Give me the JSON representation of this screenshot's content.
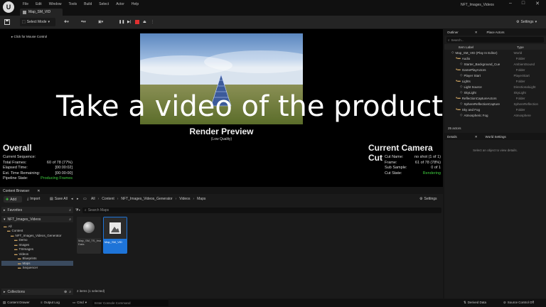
{
  "titlebar": {
    "menu": [
      "File",
      "Edit",
      "Window",
      "Tools",
      "Build",
      "Select",
      "Actor",
      "Help"
    ],
    "level_tab": "Map_SM_VID",
    "project": "NFT_Images_Videos"
  },
  "toolbar": {
    "select_mode": "Select Mode",
    "settings": "Settings"
  },
  "viewport": {
    "click_hint": "Click for Mouse Control",
    "overlay_text": "Take a video of the product",
    "render_preview": "Render Preview",
    "quality": "(Low Quality)",
    "overall": {
      "title": "Overall",
      "rows": [
        {
          "label": "Current Sequence:",
          "value": ""
        },
        {
          "label": "Total Frames:",
          "value": "60 of 78 (77%)"
        },
        {
          "label": "Elapsed Time:",
          "value": "[00:00:02]"
        },
        {
          "label": "Est. Time Remaining:",
          "value": "[00:00:00]"
        },
        {
          "label": "Pipeline State:",
          "value": "Producing Frames"
        }
      ]
    },
    "camera_cut": {
      "title": "Current Camera Cut",
      "rows": [
        {
          "label": "Cut Name:",
          "value": "no shot (1 of 1)"
        },
        {
          "label": "Frame:",
          "value": "61 of 78 (78%)"
        },
        {
          "label": "Sub Sample:",
          "value": "0 of 1"
        },
        {
          "label": "Cut State:",
          "value": "Rendering"
        }
      ]
    }
  },
  "outliner": {
    "tab": "Outliner",
    "tab2": "Place Actors",
    "search_placeholder": "Search...",
    "col_label": "Item Label",
    "col_type": "Type",
    "rows": [
      {
        "label": "Map_SM_VID (Play In Editor)",
        "type": "World",
        "indent": 1
      },
      {
        "label": "Audio",
        "type": "Folder",
        "indent": 2
      },
      {
        "label": "Starter_Background_Cue",
        "type": "AmbientSound",
        "indent": 3
      },
      {
        "label": "GamePlayActors",
        "type": "Folder",
        "indent": 2
      },
      {
        "label": "Player Start",
        "type": "PlayerStart",
        "indent": 3
      },
      {
        "label": "Lights",
        "type": "Folder",
        "indent": 2
      },
      {
        "label": "Light Source",
        "type": "DirectionalLight",
        "indent": 3
      },
      {
        "label": "SkyLight",
        "type": "SkyLight",
        "indent": 3
      },
      {
        "label": "ReflectionCaptureActors",
        "type": "Folder",
        "indent": 2
      },
      {
        "label": "SphereReflectionCapture",
        "type": "SphereReflection",
        "indent": 3
      },
      {
        "label": "Sky and Fog",
        "type": "Folder",
        "indent": 2
      },
      {
        "label": "Atmospheric Fog",
        "type": "Atmosphere",
        "indent": 3
      }
    ],
    "count": "25 actors"
  },
  "details": {
    "tab": "Details",
    "tab2": "World Settings",
    "hint": "Select an object to view details."
  },
  "content_browser": {
    "tab": "Content Browser",
    "add": "Add",
    "import": "Import",
    "save_all": "Save All",
    "breadcrumbs": [
      "All",
      "Content",
      "NFT_Images_Videos_Generator",
      "Videos",
      "Maps"
    ],
    "settings": "Settings",
    "favorites": "Favorites",
    "project": "NFT_Images_Videos",
    "search_placeholder": "Search Maps",
    "tree": [
      {
        "label": "All",
        "indent": 0
      },
      {
        "label": "Content",
        "indent": 1
      },
      {
        "label": "NFT_Images_Videos_Generator",
        "indent": 2
      },
      {
        "label": "Demo",
        "indent": 3
      },
      {
        "label": "Images",
        "indent": 3
      },
      {
        "label": "TSImages",
        "indent": 3
      },
      {
        "label": "Videos",
        "indent": 3
      },
      {
        "label": "Blueprints",
        "indent": 4
      },
      {
        "label": "Maps",
        "indent": 4
      },
      {
        "label": "Sequencer",
        "indent": 4
      }
    ],
    "assets": [
      {
        "name": "Map_SM_TS_Images_Built Data"
      },
      {
        "name": "Map_SM_VID"
      }
    ],
    "collections": "Collections",
    "status": "2 items (1 selected)"
  },
  "statusbar": {
    "content_drawer": "Content Drawer",
    "output_log": "Output Log",
    "cmd": "Cmd",
    "console_placeholder": "Enter Console Command",
    "derived_data": "Derived Data",
    "source_control": "Source Control Off"
  }
}
